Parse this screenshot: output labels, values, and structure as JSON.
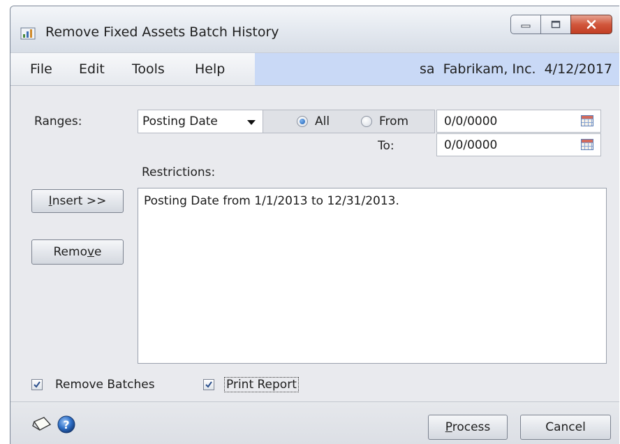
{
  "window": {
    "title": "Remove Fixed Assets Batch History",
    "icon": "fixed-assets-app-icon",
    "controls": [
      "minimize-icon",
      "maximize-icon",
      "close-icon"
    ]
  },
  "menu": {
    "items": [
      "File",
      "Edit",
      "Tools",
      "Help"
    ],
    "user": "sa",
    "company": "Fabrikam, Inc.",
    "date": "4/12/2017"
  },
  "ranges": {
    "label": "Ranges:",
    "selected": "Posting Date",
    "all_label": "All",
    "from_label": "From",
    "to_label": "To:",
    "selected_option": "All",
    "from_value": "0/0/0000",
    "to_value": "0/0/0000"
  },
  "restrictions": {
    "label": "Restrictions:",
    "items": [
      "Posting Date from 1/1/2013 to 12/31/2013."
    ]
  },
  "buttons": {
    "insert_prefix": "I",
    "insert_rest": "nsert >>",
    "remove_prefix": "Remo",
    "remove_underline": "v",
    "remove_rest": "e",
    "process_prefix": "P",
    "process_rest": "rocess",
    "cancel": "Cancel"
  },
  "options": {
    "remove_batches_label": "Remove Batches",
    "remove_batches_checked": true,
    "print_report_label": "Print Report",
    "print_report_checked": true
  },
  "footer": {
    "icons": [
      "note-icon",
      "help-icon"
    ]
  },
  "colors": {
    "user_info_bg": "#c9d9f6",
    "close_button": "#c8482c",
    "radio_selected": "#1a5fb4"
  }
}
